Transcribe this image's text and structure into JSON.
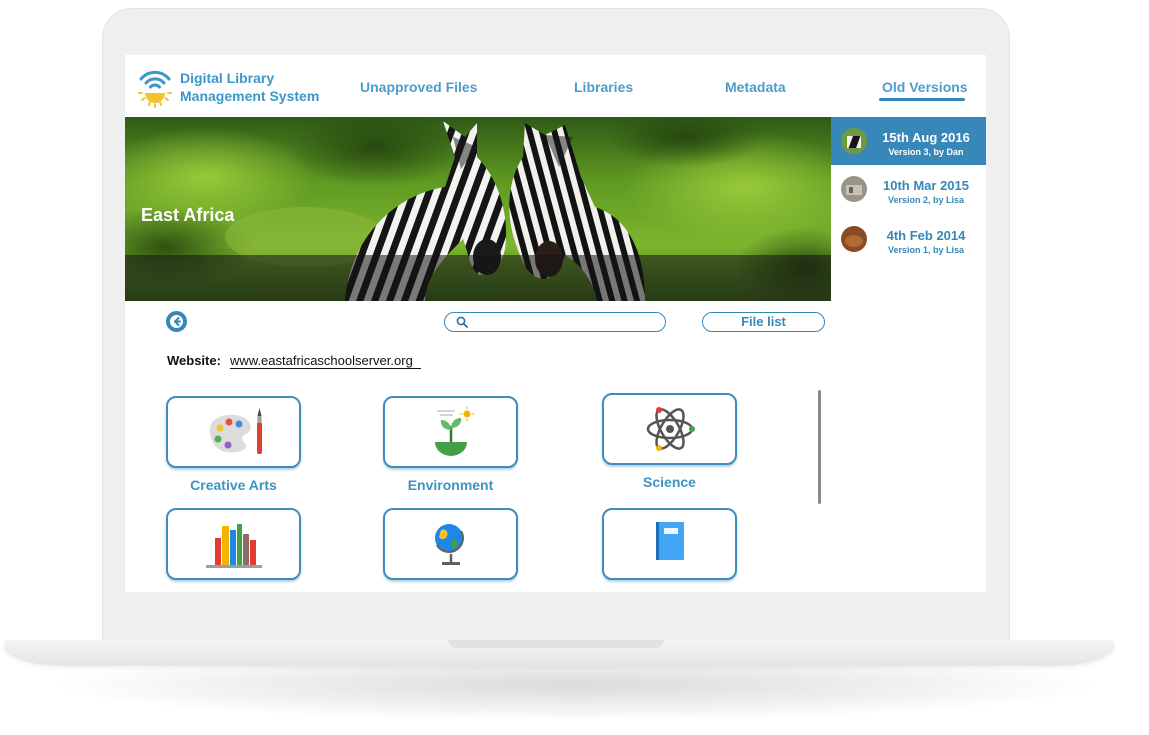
{
  "app": {
    "brand_line1": "Digital Library",
    "brand_line2": "Management System"
  },
  "nav": {
    "unapproved": "Unapproved Files",
    "libraries": "Libraries",
    "metadata": "Metadata",
    "old_versions": "Old Versions",
    "active": "Old Versions"
  },
  "hero": {
    "title": "East Africa"
  },
  "versions": [
    {
      "date": "15th  Aug 2016",
      "sub": "Version 3, by Dan",
      "active": true
    },
    {
      "date": "10th Mar 2015",
      "sub": "Version 2, by Lisa",
      "active": false
    },
    {
      "date": "4th Feb 2014",
      "sub": "Version 1, by Lisa",
      "active": false
    }
  ],
  "search": {
    "placeholder": "",
    "value": ""
  },
  "file_list_label": "File list",
  "website": {
    "label": "Website:",
    "url": "www.eastafricaschoolserver.org"
  },
  "categories": [
    {
      "label": "Creative Arts",
      "icon": "palette-icon"
    },
    {
      "label": "Environment",
      "icon": "plant-icon"
    },
    {
      "label": "Science",
      "icon": "atom-icon"
    },
    {
      "label": "",
      "icon": "books-icon"
    },
    {
      "label": "",
      "icon": "globe-icon"
    },
    {
      "label": "",
      "icon": "book-icon"
    }
  ],
  "colors": {
    "accent": "#3787b8",
    "link": "#4d9ccb"
  }
}
